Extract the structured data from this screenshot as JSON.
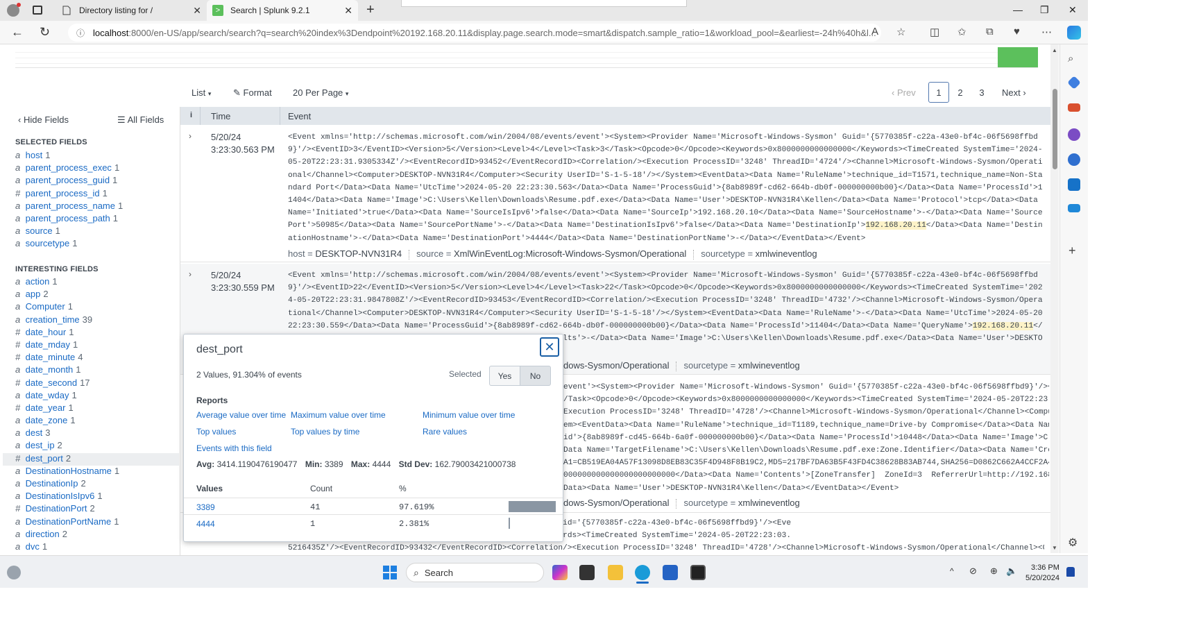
{
  "browser": {
    "tabs": [
      {
        "title": "Directory listing for /"
      },
      {
        "title": "Search | Splunk 9.2.1"
      }
    ],
    "url_host": "localhost",
    "url_rest": ":8000/en-US/app/search/search?q=search%20index%3Dendpoint%20192.168.20.11&display.page.search.mode=smart&dispatch.sample_ratio=1&workload_pool=&earliest=-24h%40h&l..."
  },
  "toolbar": {
    "list_label": "List",
    "format_label": "Format",
    "perpage_label": "20 Per Page",
    "prev_label": "Prev",
    "pages": [
      "1",
      "2",
      "3"
    ],
    "next_label": "Next"
  },
  "fields_panel": {
    "hide_label": "Hide Fields",
    "all_label": "All Fields",
    "selected_heading": "SELECTED FIELDS",
    "selected": [
      {
        "type": "a",
        "name": "host",
        "count": "1"
      },
      {
        "type": "a",
        "name": "parent_process_exec",
        "count": "1"
      },
      {
        "type": "a",
        "name": "parent_process_guid",
        "count": "1"
      },
      {
        "type": "#",
        "name": "parent_process_id",
        "count": "1"
      },
      {
        "type": "a",
        "name": "parent_process_name",
        "count": "1"
      },
      {
        "type": "a",
        "name": "parent_process_path",
        "count": "1"
      },
      {
        "type": "a",
        "name": "source",
        "count": "1"
      },
      {
        "type": "a",
        "name": "sourcetype",
        "count": "1"
      }
    ],
    "interesting_heading": "INTERESTING FIELDS",
    "interesting": [
      {
        "type": "a",
        "name": "action",
        "count": "1"
      },
      {
        "type": "a",
        "name": "app",
        "count": "2"
      },
      {
        "type": "a",
        "name": "Computer",
        "count": "1"
      },
      {
        "type": "a",
        "name": "creation_time",
        "count": "39"
      },
      {
        "type": "#",
        "name": "date_hour",
        "count": "1"
      },
      {
        "type": "#",
        "name": "date_mday",
        "count": "1"
      },
      {
        "type": "#",
        "name": "date_minute",
        "count": "4"
      },
      {
        "type": "a",
        "name": "date_month",
        "count": "1"
      },
      {
        "type": "#",
        "name": "date_second",
        "count": "17"
      },
      {
        "type": "a",
        "name": "date_wday",
        "count": "1"
      },
      {
        "type": "#",
        "name": "date_year",
        "count": "1"
      },
      {
        "type": "a",
        "name": "date_zone",
        "count": "1"
      },
      {
        "type": "a",
        "name": "dest",
        "count": "3"
      },
      {
        "type": "a",
        "name": "dest_ip",
        "count": "2"
      },
      {
        "type": "#",
        "name": "dest_port",
        "count": "2"
      },
      {
        "type": "a",
        "name": "DestinationHostname",
        "count": "1"
      },
      {
        "type": "a",
        "name": "DestinationIp",
        "count": "2"
      },
      {
        "type": "a",
        "name": "DestinationIsIpv6",
        "count": "1"
      },
      {
        "type": "#",
        "name": "DestinationPort",
        "count": "2"
      },
      {
        "type": "a",
        "name": "DestinationPortName",
        "count": "1"
      },
      {
        "type": "a",
        "name": "direction",
        "count": "2"
      },
      {
        "type": "a",
        "name": "dvc",
        "count": "1"
      }
    ]
  },
  "events_header": {
    "info": "i",
    "time": "Time",
    "event": "Event"
  },
  "events": [
    {
      "date": "5/20/24",
      "time": "3:23:30.563 PM",
      "raw_before": "<Event xmlns='http://schemas.microsoft.com/win/2004/08/events/event'><System><Provider Name='Microsoft-Windows-Sysmon' Guid='{5770385f-c22a-43e0-bf4c-06f5698ffbd9}'/><EventID>3</EventID><Version>5</Version><Level>4</Level><Task>3</Task><Opcode>0</Opcode><Keywords>0x8000000000000000</Keywords><TimeCreated SystemTime='2024-05-20T22:23:31.9305334Z'/><EventRecordID>93452</EventRecordID><Correlation/><Execution ProcessID='3248' ThreadID='4724'/><Channel>Microsoft-Windows-Sysmon/Operational</Channel><Computer>DESKTOP-NVN31R4</Computer><Security UserID='S-1-5-18'/></System><EventData><Data Name='RuleName'>technique_id=T1571,technique_name=Non-Standard Port</Data><Data Name='UtcTime'>2024-05-20 22:23:30.563</Data><Data Name='ProcessGuid'>{8ab8989f-cd62-664b-db0f-000000000b00}</Data><Data Name='ProcessId'>11404</Data><Data Name='Image'>C:\\Users\\Kellen\\Downloads\\Resume.pdf.exe</Data><Data Name='User'>DESKTOP-NVN31R4\\Kellen</Data><Data Name='Protocol'>tcp</Data><Data Name='Initiated'>true</Data><Data Name='SourceIsIpv6'>false</Data><Data Name='SourceIp'>192.168.20.10</Data><Data Name='SourceHostname'>-</Data><Data Name='SourcePort'>50985</Data><Data Name='SourcePortName'>-</Data><Data Name='DestinationIsIpv6'>false</Data><Data Name='DestinationIp'>",
      "raw_hl": "192.168.20.11",
      "raw_after": "</Data><Data Name='DestinationHostname'>-</Data><Data Name='DestinationPort'>4444</Data><Data Name='DestinationPortName'>-</Data></EventData></Event>",
      "host": "DESKTOP-NVN31R4",
      "source": "XmlWinEventLog:Microsoft-Windows-Sysmon/Operational",
      "sourcetype": "xmlwineventlog"
    },
    {
      "date": "5/20/24",
      "time": "3:23:30.559 PM",
      "raw_before": "<Event xmlns='http://schemas.microsoft.com/win/2004/08/events/event'><System><Provider Name='Microsoft-Windows-Sysmon' Guid='{5770385f-c22a-43e0-bf4c-06f5698ffbd9}'/><EventID>22</EventID><Version>5</Version><Level>4</Level><Task>22</Task><Opcode>0</Opcode><Keywords>0x8000000000000000</Keywords><TimeCreated SystemTime='2024-05-20T22:23:31.9847808Z'/><EventRecordID>93453</EventRecordID><Correlation/><Execution ProcessID='3248' ThreadID='4732'/><Channel>Microsoft-Windows-Sysmon/Operational</Channel><Computer>DESKTOP-NVN31R4</Computer><Security UserID='S-1-5-18'/></System><EventData><Data Name='RuleName'>-</Data><Data Name='UtcTime'>2024-05-20 22:23:30.559</Data><Data Name='ProcessGuid'>{8ab8989f-cd62-664b-db0f-000000000b00}</Data><Data Name='ProcessId'>11404</Data><Data Name='QueryName'>",
      "raw_hl": "192.168.20.11",
      "raw_after": "</Data><Data Name='QueryStatus'>0</Data><Data Name='QueryResults'>-</Data><Data Name='Image'>C:\\Users\\Kellen\\Downloads\\Resume.pdf.exe</Data><Data Name='User'>DESKTOP-NVN31R4\\Kellen</Data></EventData></Event>",
      "sourcetype": "xmlwineventlog",
      "source_tail": "dows-Sysmon/Operational"
    },
    {
      "raw_lines": [
        "event'><System><Provider Name='Microsoft-Windows-Sysmon' Guid='{5770385f-c22a-43e0-bf4c-06f5698ffbd9}'/><Eve",
        "/Task><Opcode>0</Opcode><Keywords>0x8000000000000000</Keywords><TimeCreated SystemTime='2024-05-20T22:23:03.",
        "Execution ProcessID='3248' ThreadID='4728'/><Channel>Microsoft-Windows-Sysmon/Operational</Channel><Computer",
        "em><EventData><Data Name='RuleName'>technique_id=T1189,technique_name=Drive-by Compromise</Data><Data Name",
        "id'>{8ab8989f-cd45-664b-6a0f-000000000b00}</Data><Data Name='ProcessId'>10448</Data><Data Name='Image'>C:\\Pr",
        "Data Name='TargetFilename'>C:\\Users\\Kellen\\Downloads\\Resume.pdf.exe:Zone.Identifier</Data><Data Name='Creat",
        "A1=CB519EA04A57F13098D8EB83C35F4D948F8B19C2,MD5=217BF7DA63B5F43FD4C38628B83AB744,SHA256=D0862C662A4CCF2A468A",
        "000000000000000000000000</Data><Data Name='Contents'>[ZoneTransfer]  ZoneId=3  ReferrerUrl=http://192.168.20.",
        "Data><Data Name='User'>DESKTOP-NVN31R4\\Kellen</Data></EventData></Event>"
      ],
      "source_tail": "dows-Sysmon/Operational",
      "sourcetype": "xmlwineventlog"
    },
    {
      "raw_lines": [
        "event'><System><Provider Name='Microsoft-Windows-Sysmon' Guid='{5770385f-c22a-43e0-bf4c-06f5698ffbd9}'/><Eve",
        "/Task><Opcode>0</Opcode><Keywords>0x8000000000000000</Keywords><TimeCreated SystemTime='2024-05-20T22:23:03.",
        "5216435Z'/><EventRecordID>93432</EventRecordID><Correlation/><Execution ProcessID='3248' ThreadID='4728'/><Channel>Microsoft-Windows-Sysmon/Operational</Channel><Computer"
      ]
    }
  ],
  "popup": {
    "title": "dest_port",
    "summary": "2 Values, 91.304% of events",
    "selected_label": "Selected",
    "yes_label": "Yes",
    "no_label": "No",
    "reports_heading": "Reports",
    "links": {
      "avg": "Average value over time",
      "max": "Maximum value over time",
      "min": "Minimum value over time",
      "top": "Top values",
      "topbytime": "Top values by time",
      "rare": "Rare values",
      "events": "Events with this field"
    },
    "avg_label": "Avg:",
    "avg_value": "3414.1190476190477",
    "min_label": "Min:",
    "min_value": "3389",
    "max_label": "Max:",
    "max_value": "4444",
    "std_label": "Std Dev:",
    "std_value": "162.79003421000738",
    "col_values": "Values",
    "col_count": "Count",
    "col_pct": "%",
    "rows": [
      {
        "value": "3389",
        "count": "41",
        "pct": "97.619%",
        "fraction": 0.97619
      },
      {
        "value": "4444",
        "count": "1",
        "pct": "2.381%",
        "fraction": 0.02381
      }
    ]
  },
  "taskbar": {
    "search_label": "Search",
    "time": "3:36 PM",
    "date": "5/20/2024"
  },
  "colors": {
    "link": "#1a6ac4",
    "accent_green": "#5cc05c",
    "highlight": "#fdf3c8"
  }
}
